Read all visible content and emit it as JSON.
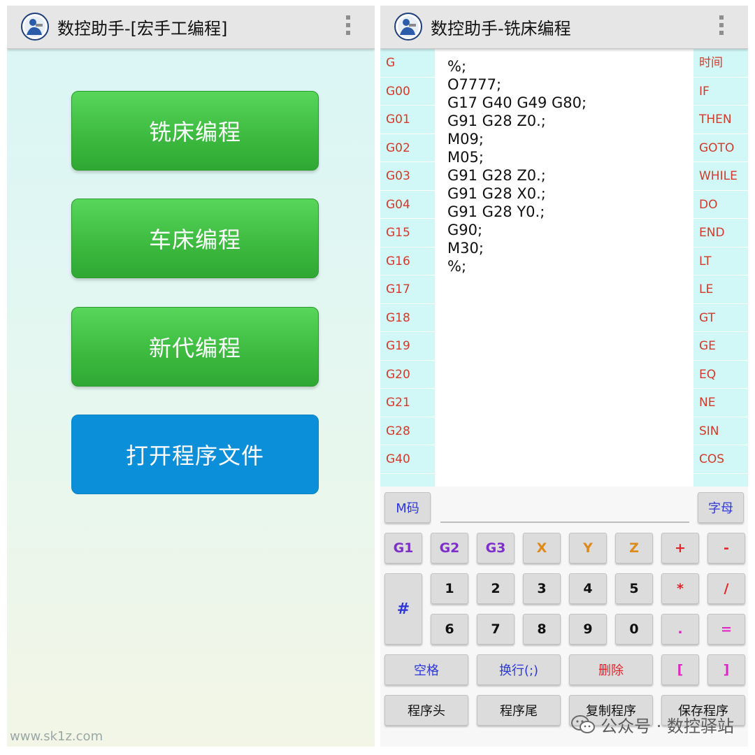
{
  "left_screen": {
    "title": "数控助手-[宏手工编程]",
    "menu": [
      {
        "label": "铣床编程"
      },
      {
        "label": "车床编程"
      },
      {
        "label": "新代编程"
      },
      {
        "label": "打开程序文件"
      }
    ],
    "watermark": "www.sk1z.com"
  },
  "right_screen": {
    "title": "数控助手-铣床编程",
    "g_codes": [
      "G",
      "G00",
      "G01",
      "G02",
      "G03",
      "G04",
      "G15",
      "G16",
      "G17",
      "G18",
      "G19",
      "G20",
      "G21",
      "G28",
      "G40"
    ],
    "keywords": [
      "时间",
      "IF",
      "THEN",
      "GOTO",
      "WHILE",
      "DO",
      "END",
      "LT",
      "LE",
      "GT",
      "GE",
      "EQ",
      "NE",
      "SIN",
      "COS"
    ],
    "program_lines": [
      "%;",
      "O7777;",
      "G17 G40 G49 G80;",
      "G91 G28 Z0.;",
      "M09;",
      "M05;",
      "G91 G28 Z0.;",
      "G91 G28 X0.;",
      "G91 G28 Y0.;",
      "G90;",
      "M30;",
      "%;"
    ],
    "keys": {
      "m_code": "M码",
      "letters": "字母",
      "g1": "G1",
      "g2": "G2",
      "g3": "G3",
      "x": "X",
      "y": "Y",
      "z": "Z",
      "plus": "+",
      "minus": "-",
      "hash": "#",
      "d1": "1",
      "d2": "2",
      "d3": "3",
      "d4": "4",
      "d5": "5",
      "d6": "6",
      "d7": "7",
      "d8": "8",
      "d9": "9",
      "d0": "0",
      "mult": "*",
      "div": "/",
      "dot": ".",
      "equals": "=",
      "space": "空格",
      "newline": "换行(;)",
      "delete": "删除",
      "lbracket": "[",
      "rbracket": "]",
      "prog_head": "程序头",
      "prog_tail": "程序尾",
      "copy_prog": "复制程序",
      "save_prog": "保存程序"
    }
  },
  "wechat_watermark": "公众号 · 数控驿站"
}
